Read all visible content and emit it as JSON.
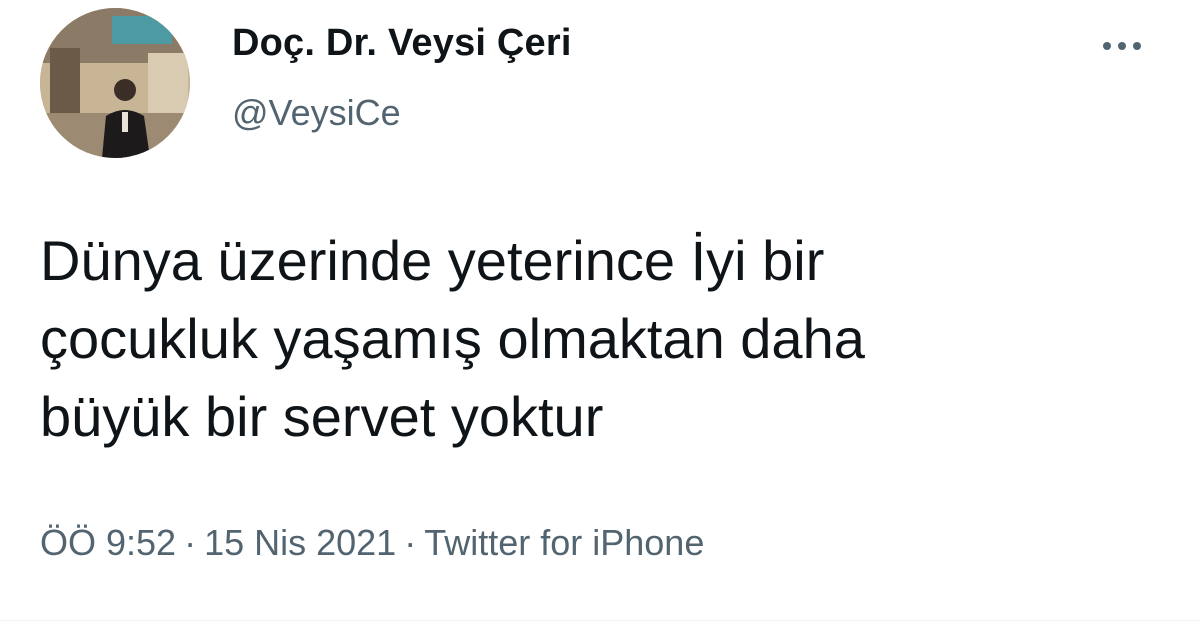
{
  "author": {
    "display_name": "Doç. Dr. Veysi Çeri",
    "handle": "@VeysiCe",
    "avatar_icon": "profile-photo"
  },
  "more_icon": "more-horizontal-icon",
  "tweet": {
    "lines": [
      "Dünya üzerinde yeterince İyi bir",
      "çocukluk yaşamış olmaktan daha",
      "büyük bir servet yoktur"
    ]
  },
  "meta": {
    "time": "ÖÖ 9:52",
    "separator": "·",
    "date": "15 Nis 2021",
    "source": "Twitter for iPhone"
  },
  "colors": {
    "text_primary": "#0f1419",
    "text_secondary": "#536471",
    "background": "#ffffff"
  }
}
